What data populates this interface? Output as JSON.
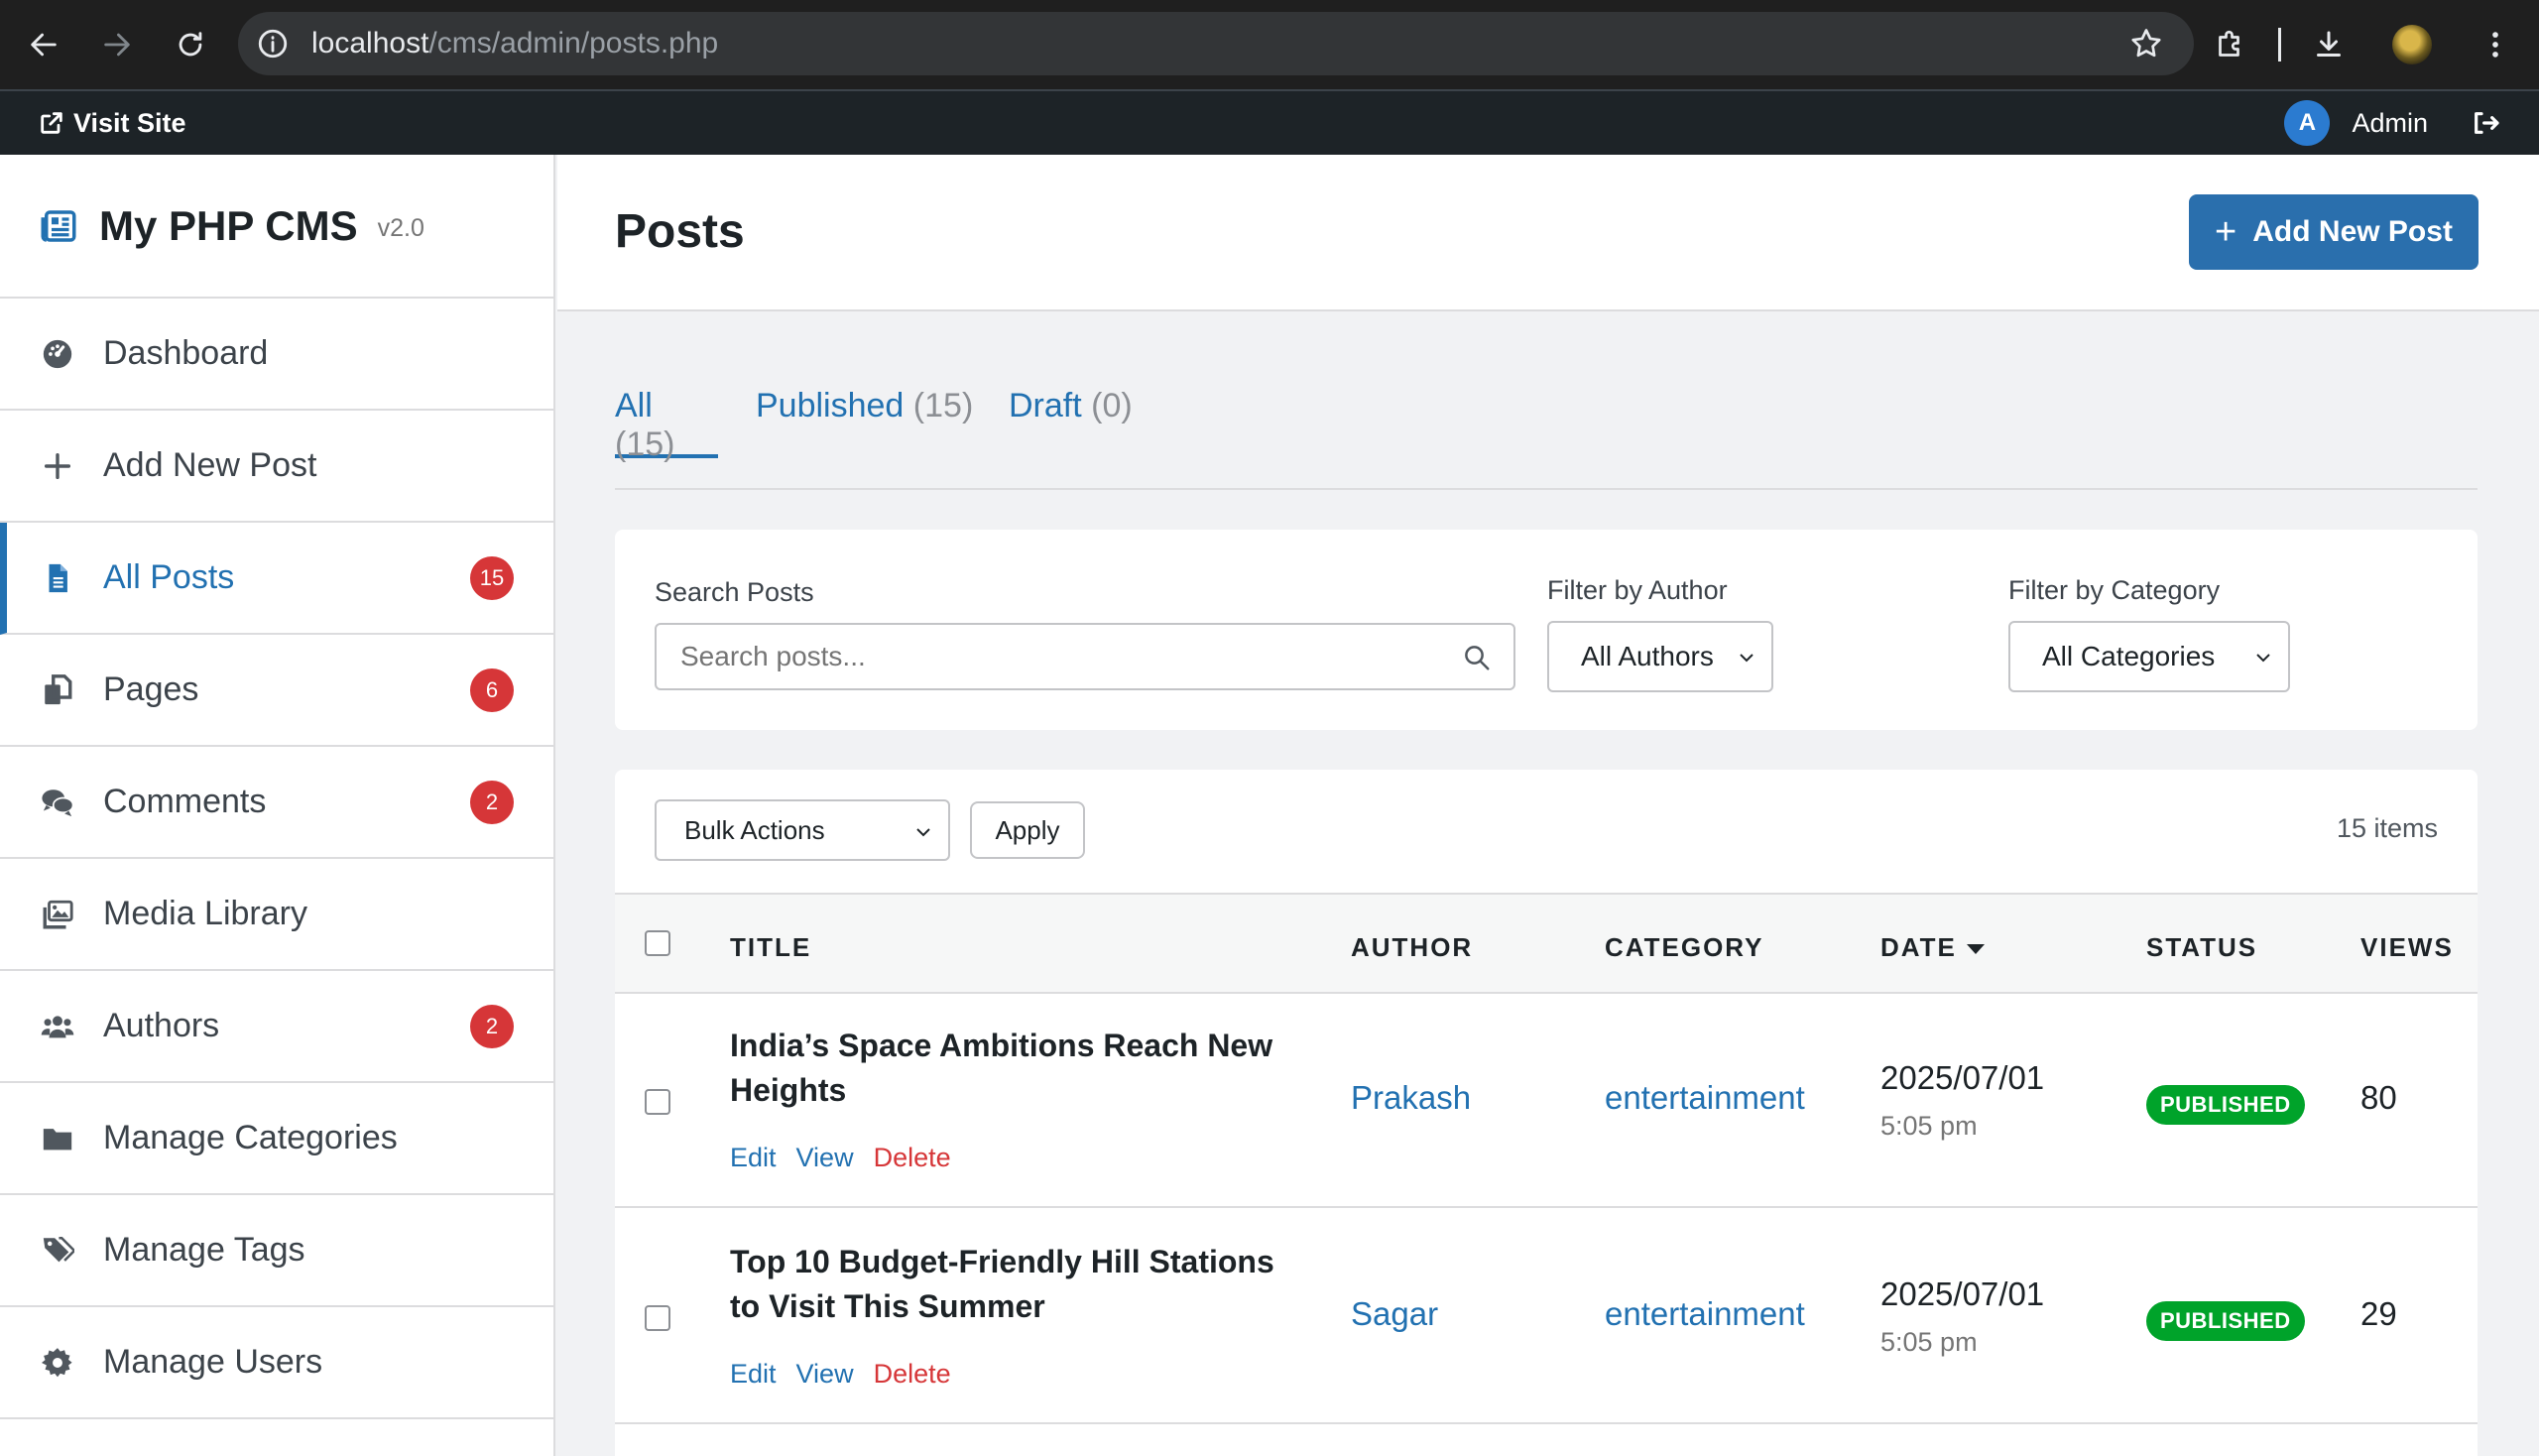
{
  "browser": {
    "url_host": "localhost",
    "url_path": "/cms/admin/posts.php"
  },
  "admin_bar": {
    "visit_site": "Visit Site",
    "avatar_letter": "A",
    "user_name": "Admin"
  },
  "brand": {
    "name": "My PHP CMS",
    "version": "v2.0"
  },
  "sidebar": {
    "items": [
      {
        "label": "Dashboard",
        "icon": "dashboard-icon",
        "badge": null
      },
      {
        "label": "Add New Post",
        "icon": "plus-icon",
        "badge": null
      },
      {
        "label": "All Posts",
        "icon": "file-icon",
        "badge": "15",
        "active": true
      },
      {
        "label": "Pages",
        "icon": "copy-icon",
        "badge": "6"
      },
      {
        "label": "Comments",
        "icon": "comments-icon",
        "badge": "2"
      },
      {
        "label": "Media Library",
        "icon": "images-icon",
        "badge": null
      },
      {
        "label": "Authors",
        "icon": "users-icon",
        "badge": "2"
      },
      {
        "label": "Manage Categories",
        "icon": "folder-icon",
        "badge": null
      },
      {
        "label": "Manage Tags",
        "icon": "tags-icon",
        "badge": null
      },
      {
        "label": "Manage Users",
        "icon": "gear-icon",
        "badge": null
      }
    ]
  },
  "header": {
    "title": "Posts",
    "add_new_label": "Add New Post"
  },
  "tabs": [
    {
      "label": "All",
      "count": "(15)",
      "active": true
    },
    {
      "label": "Published",
      "count": "(15)"
    },
    {
      "label": "Draft",
      "count": "(0)"
    }
  ],
  "filters": {
    "search_label": "Search Posts",
    "search_placeholder": "Search posts...",
    "search_value": "",
    "author_label": "Filter by Author",
    "author_value": "All Authors",
    "category_label": "Filter by Category",
    "category_value": "All Categories"
  },
  "table": {
    "bulk_value": "Bulk Actions",
    "apply_label": "Apply",
    "items_count": "15 items",
    "headers": {
      "title": "TITLE",
      "author": "AUTHOR",
      "category": "CATEGORY",
      "date": "DATE",
      "status": "STATUS",
      "views": "VIEWS"
    },
    "row_actions": {
      "edit": "Edit",
      "view": "View",
      "delete": "Delete"
    },
    "rows": [
      {
        "title": "India’s Space Ambitions Reach New Heights",
        "author": "Prakash",
        "category": "entertainment",
        "date": "2025/07/01",
        "time": "5:05 pm",
        "status": "PUBLISHED",
        "views": "80"
      },
      {
        "title": "Top 10 Budget-Friendly Hill Stations to Visit This Summer",
        "author": "Sagar",
        "category": "entertainment",
        "date": "2025/07/01",
        "time": "5:05 pm",
        "status": "PUBLISHED",
        "views": "29"
      }
    ]
  },
  "colors": {
    "accent": "#2271b1",
    "primary_button": "#2a6fad",
    "badge": "#d63638",
    "published": "#00a32a",
    "admin_bar": "#1d2327"
  }
}
